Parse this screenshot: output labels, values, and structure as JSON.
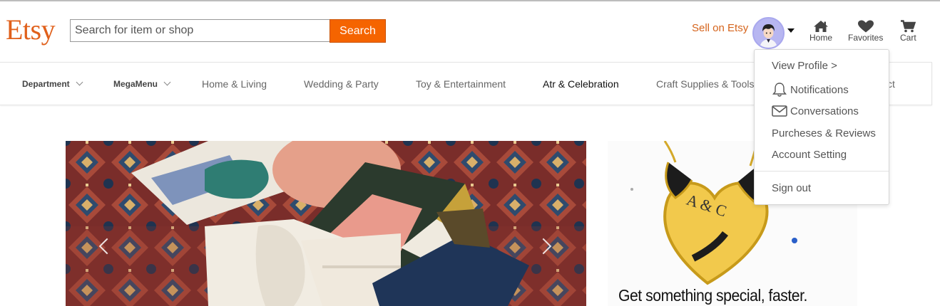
{
  "header": {
    "logo": "Etsy",
    "search_placeholder": "Search for item or shop",
    "search_button": "Search",
    "sell_link": "Sell on Etsy",
    "nav": {
      "home": "Home",
      "favorites": "Favorites",
      "cart": "Cart"
    },
    "icons": [
      "home-icon",
      "heart-icon",
      "cart-icon",
      "avatar",
      "caret-down-icon"
    ]
  },
  "categories": [
    {
      "label": "Department",
      "dropdown": true
    },
    {
      "label": "MegaMenu",
      "dropdown": true
    },
    {
      "label": "Home & Living"
    },
    {
      "label": "Wedding & Party"
    },
    {
      "label": "Toy & Entertainment"
    },
    {
      "label": "Atr & Celebration"
    },
    {
      "label": "Craft Supplies & Tools"
    },
    {
      "label": "ct"
    }
  ],
  "user_menu": {
    "view_profile": "View Profile >",
    "notifications": "Notifications",
    "conversations": "Conversations",
    "purchases": "Purcheses & Reviews",
    "account": "Account Setting",
    "sign_out": "Sign out"
  },
  "promo": {
    "headline": "Get something special, faster.",
    "pendant_text": "A & C"
  },
  "colors": {
    "brand": "#f56400",
    "logo": "#e0601b",
    "sell_link": "#d5641c"
  }
}
